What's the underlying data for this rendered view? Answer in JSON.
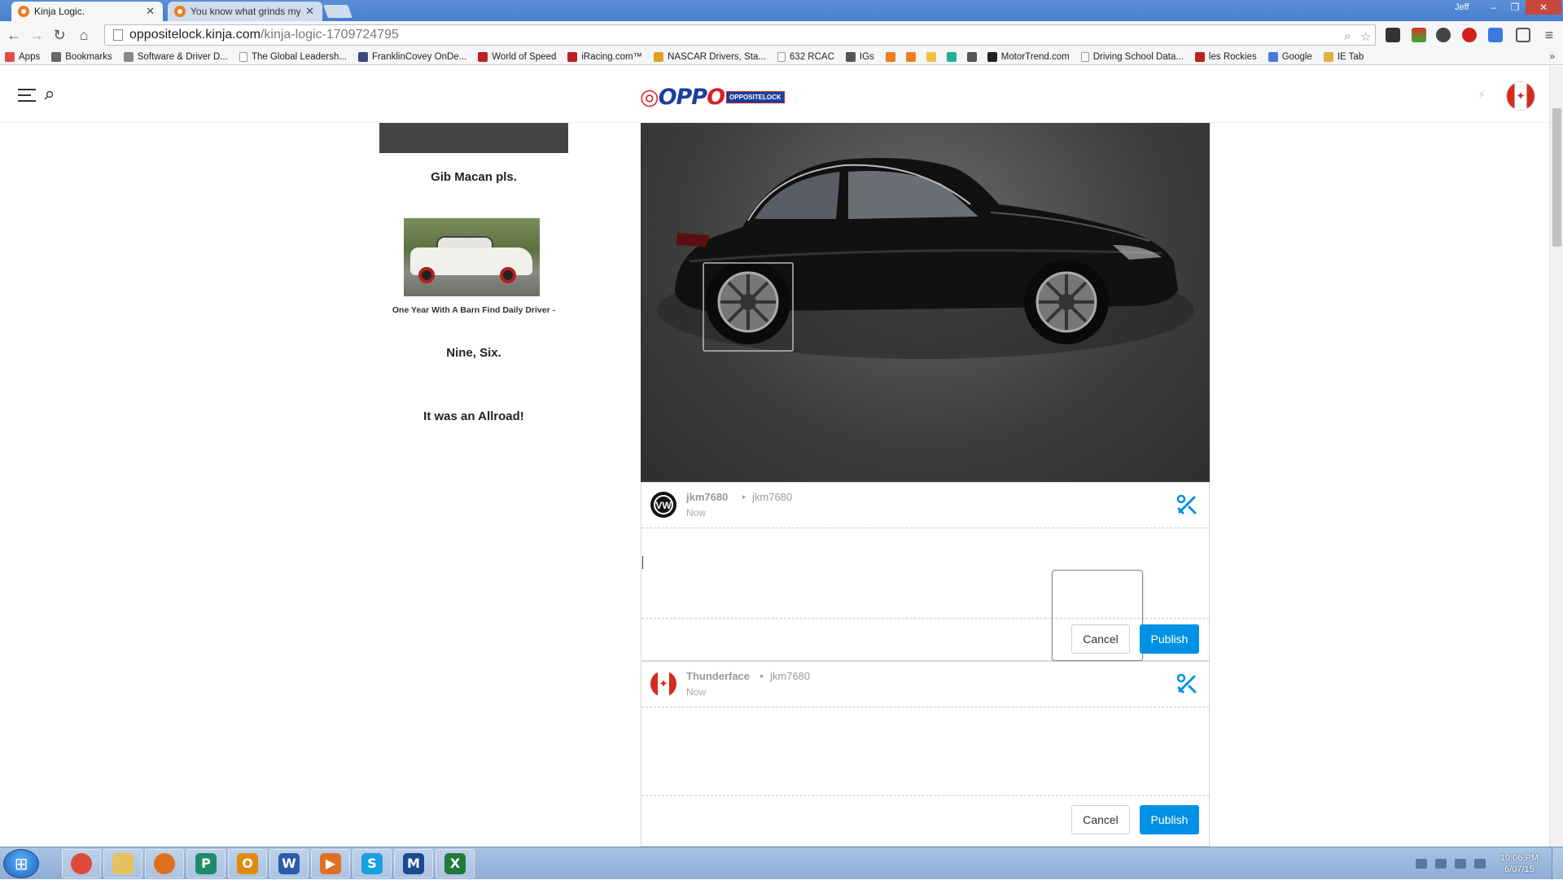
{
  "browser": {
    "tabs": [
      {
        "title": "Kinja Logic.",
        "active": true
      },
      {
        "title": "You know what grinds my",
        "active": false
      }
    ],
    "window_user": "Jeff",
    "window_controls": {
      "minimize": "–",
      "restore": "❐",
      "close": "✕"
    },
    "url_host": "oppositelock.kinja.com",
    "url_path": "/kinja-logic-1709724795",
    "bookmarks": [
      {
        "label": "Apps",
        "color": "#e34b4b"
      },
      {
        "label": "Bookmarks",
        "color": "#666666"
      },
      {
        "label": "Software & Driver D...",
        "color": "#888888"
      },
      {
        "label": "The Global Leadersh...",
        "color": "page"
      },
      {
        "label": "FranklinCovey OnDe...",
        "color": "#3a4a7a"
      },
      {
        "label": "World of Speed",
        "color": "#c02020"
      },
      {
        "label": "iRacing.com™",
        "color": "#c02020"
      },
      {
        "label": "NASCAR Drivers, Sta...",
        "color": "#e0a020"
      },
      {
        "label": "632 RCAC",
        "color": "page"
      },
      {
        "label": "IGs",
        "color": "#555555"
      },
      {
        "label": "",
        "color": "#f07d1a"
      },
      {
        "label": "",
        "color": "#f07d1a"
      },
      {
        "label": "",
        "color": "#f0c040"
      },
      {
        "label": "",
        "color": "#20b090"
      },
      {
        "label": "",
        "color": "#555555"
      },
      {
        "label": "MotorTrend.com",
        "color": "#222222"
      },
      {
        "label": "Driving School Data...",
        "color": "page"
      },
      {
        "label": "les Rockies",
        "color": "#c02020"
      },
      {
        "label": "Google",
        "color": "#4a7adf"
      },
      {
        "label": "IE Tab",
        "color": "#e0b040"
      }
    ],
    "bookmarks_overflow": "»"
  },
  "site": {
    "logo_text_1": "OPP",
    "logo_text_2": "O",
    "logo_tag": "OPPOSITELOCK"
  },
  "sidebar": {
    "item1_title": "Gib Macan pls.",
    "item2_caption": "One Year With A Barn Find Daily Driver -",
    "item3_title": "Nine, Six.",
    "item4_title": "It was an Allroad!"
  },
  "replies": [
    {
      "author": "jkm7680",
      "reply_to": "jkm7680",
      "time": "Now",
      "avatar": "vw-logo",
      "cancel_label": "Cancel",
      "publish_label": "Publish"
    },
    {
      "author": "Thunderface",
      "reply_to": "jkm7680",
      "time": "Now",
      "avatar": "canada-flag",
      "cancel_label": "Cancel",
      "publish_label": "Publish"
    }
  ],
  "taskbar": {
    "apps": [
      {
        "name": "chrome",
        "glyph": "",
        "color": "#e04a3a"
      },
      {
        "name": "explorer",
        "glyph": "",
        "color": "#e8c060"
      },
      {
        "name": "firefox",
        "glyph": "",
        "color": "#e07020"
      },
      {
        "name": "publisher",
        "glyph": "P",
        "color": "#1f8a6a"
      },
      {
        "name": "outlook",
        "glyph": "O",
        "color": "#e08a10"
      },
      {
        "name": "word",
        "glyph": "W",
        "color": "#2b5ba8"
      },
      {
        "name": "media-player",
        "glyph": "▶",
        "color": "#e07020"
      },
      {
        "name": "skype",
        "glyph": "S",
        "color": "#1aa0e0"
      },
      {
        "name": "malwarebytes",
        "glyph": "M",
        "color": "#1a4a90"
      },
      {
        "name": "excel",
        "glyph": "X",
        "color": "#1f7a3a"
      }
    ],
    "clock_time": "10:06 PM",
    "clock_date": "6/07/15"
  },
  "colors": {
    "accent": "#0091e6",
    "logo_blue": "#1a3f9c",
    "logo_red": "#d3232a"
  }
}
